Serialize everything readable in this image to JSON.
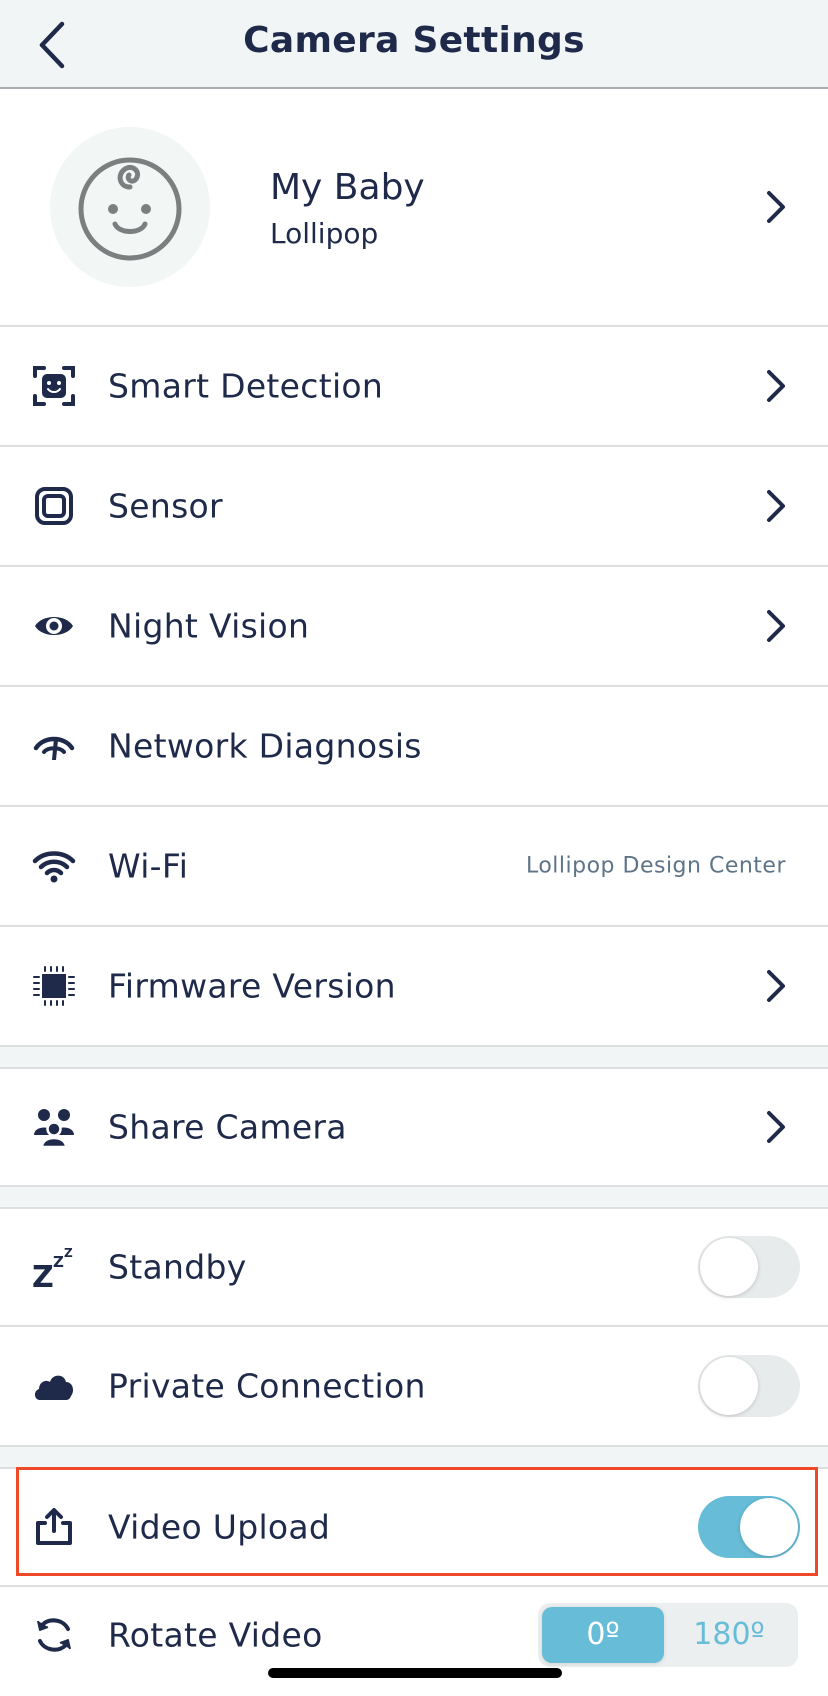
{
  "header": {
    "title": "Camera Settings",
    "back_icon": "chevron-left-icon"
  },
  "profile": {
    "name": "My Baby",
    "subtitle": "Lollipop",
    "avatar_icon": "baby-face-icon"
  },
  "settings": [
    {
      "id": "smart-detection",
      "label": "Smart Detection",
      "icon": "face-scan-icon",
      "type": "link"
    },
    {
      "id": "sensor",
      "label": "Sensor",
      "icon": "sensor-icon",
      "type": "link"
    },
    {
      "id": "night-vision",
      "label": "Night Vision",
      "icon": "eye-icon",
      "type": "link"
    },
    {
      "id": "network-diagnosis",
      "label": "Network Diagnosis",
      "icon": "speedometer-icon",
      "type": "plain"
    },
    {
      "id": "wifi",
      "label": "Wi-Fi",
      "icon": "wifi-icon",
      "type": "value",
      "value": "Lollipop Design Center"
    },
    {
      "id": "firmware-version",
      "label": "Firmware Version",
      "icon": "chip-icon",
      "type": "link"
    }
  ],
  "sharing": [
    {
      "id": "share-camera",
      "label": "Share Camera",
      "icon": "users-icon",
      "type": "link"
    }
  ],
  "toggles": [
    {
      "id": "standby",
      "label": "Standby",
      "icon": "sleep-zzz-icon",
      "on": false
    },
    {
      "id": "private-connection",
      "label": "Private Connection",
      "icon": "cloud-icon",
      "on": false
    },
    {
      "id": "video-upload",
      "label": "Video Upload",
      "icon": "upload-icon",
      "on": true,
      "highlighted": true
    }
  ],
  "rotate": {
    "label": "Rotate Video",
    "icon": "rotate-icon",
    "options": [
      "0º",
      "180º"
    ],
    "selected": "0º"
  },
  "colors": {
    "text": "#1f2a4a",
    "accent": "#67bcd7",
    "highlight": "#ee4a2a",
    "secondary_text": "#5e7488"
  }
}
